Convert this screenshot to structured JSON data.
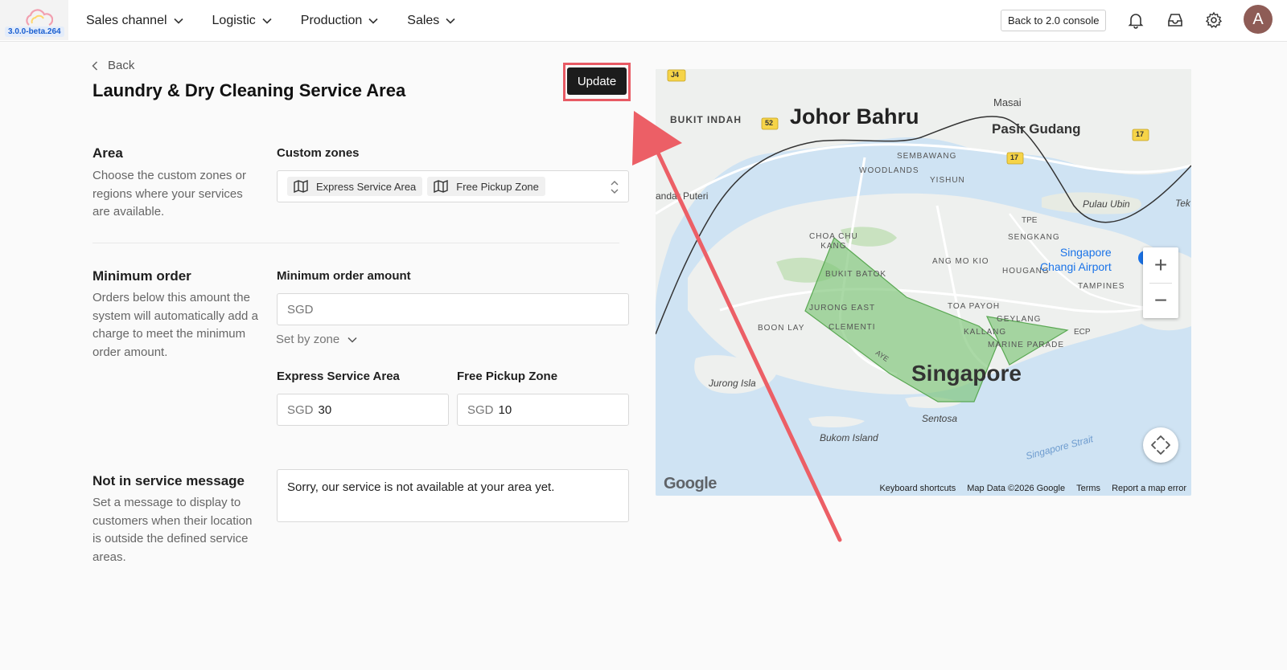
{
  "app": {
    "version": "3.0.0-beta.264"
  },
  "nav": {
    "items": [
      {
        "label": "Sales channel"
      },
      {
        "label": "Logistic"
      },
      {
        "label": "Production"
      },
      {
        "label": "Sales"
      }
    ],
    "console_button": "Back to 2.0 console",
    "avatar_initial": "A"
  },
  "header": {
    "back_label": "Back",
    "title": "Laundry & Dry Cleaning Service Area",
    "update_label": "Update"
  },
  "area": {
    "title": "Area",
    "description": "Choose the custom zones or regions where your services are available.",
    "field_label": "Custom zones",
    "chips": [
      "Express Service Area",
      "Free Pickup Zone"
    ]
  },
  "minimum_order": {
    "title": "Minimum order",
    "description": "Orders below this amount the system will automatically add a charge to meet the minimum order amount.",
    "field_label": "Minimum order amount",
    "placeholder": "SGD",
    "set_by_zone": "Set by zone",
    "zones": [
      {
        "label": "Express Service Area",
        "prefix": "SGD",
        "value": "30"
      },
      {
        "label": "Free Pickup Zone",
        "prefix": "SGD",
        "value": "10"
      }
    ]
  },
  "not_in_service": {
    "title": "Not in service message",
    "description": "Set a message to display to customers when their location is outside the defined service areas.",
    "message": "Sorry, our service is not available at your area yet."
  },
  "map": {
    "labels": {
      "johor_bahru": "Johor Bahru",
      "pasir_gudang": "Pasir Gudang",
      "masai": "Masai",
      "bukit_indah": "BUKIT INDAH",
      "sembawang": "SEMBAWANG",
      "woodlands": "WOODLANDS",
      "yishun": "YISHUN",
      "bandar_puteri": "andar Puteri",
      "pulau_ubin": "Pulau Ubin",
      "tek": "Tek",
      "tpe": "TPE",
      "sengkang": "SENGKANG",
      "choa_chu_kang": "CHOA CHU\nKANG",
      "bukit_batok": "BUKIT BATOK",
      "ang_mo_kio": "ANG MO KIO",
      "hougang": "HOUGANG",
      "changi_airport": "Singapore\nChangi Airport",
      "tampines": "TAMPINES",
      "jurong_east": "JURONG EAST",
      "toa_payoh": "TOA PAYOH",
      "geylang": "GEYLANG",
      "boon_lay": "BOON LAY",
      "clementi": "CLEMENTI",
      "kallang": "KALLANG",
      "marine_parade": "MARINE PARADE",
      "ecp": "ECP",
      "aye": "AYE",
      "singapore": "Singapore",
      "jurong_island": "Jurong Isla",
      "sentosa": "Sentosa",
      "bukom_island": "Bukom Island",
      "singapore_strait": "Singapore Strait",
      "j4": "J4",
      "r52": "52",
      "r17a": "17",
      "r17b": "17"
    },
    "footer": [
      "Keyboard shortcuts",
      "Map Data ©2026 Google",
      "Terms",
      "Report a map error"
    ],
    "logo": "Google",
    "zoom_in": "+",
    "zoom_out": "−"
  },
  "colors": {
    "accent_border": "#e85a64",
    "zone_fill": "#7cc576",
    "primary_button": "#1c1c1c"
  }
}
